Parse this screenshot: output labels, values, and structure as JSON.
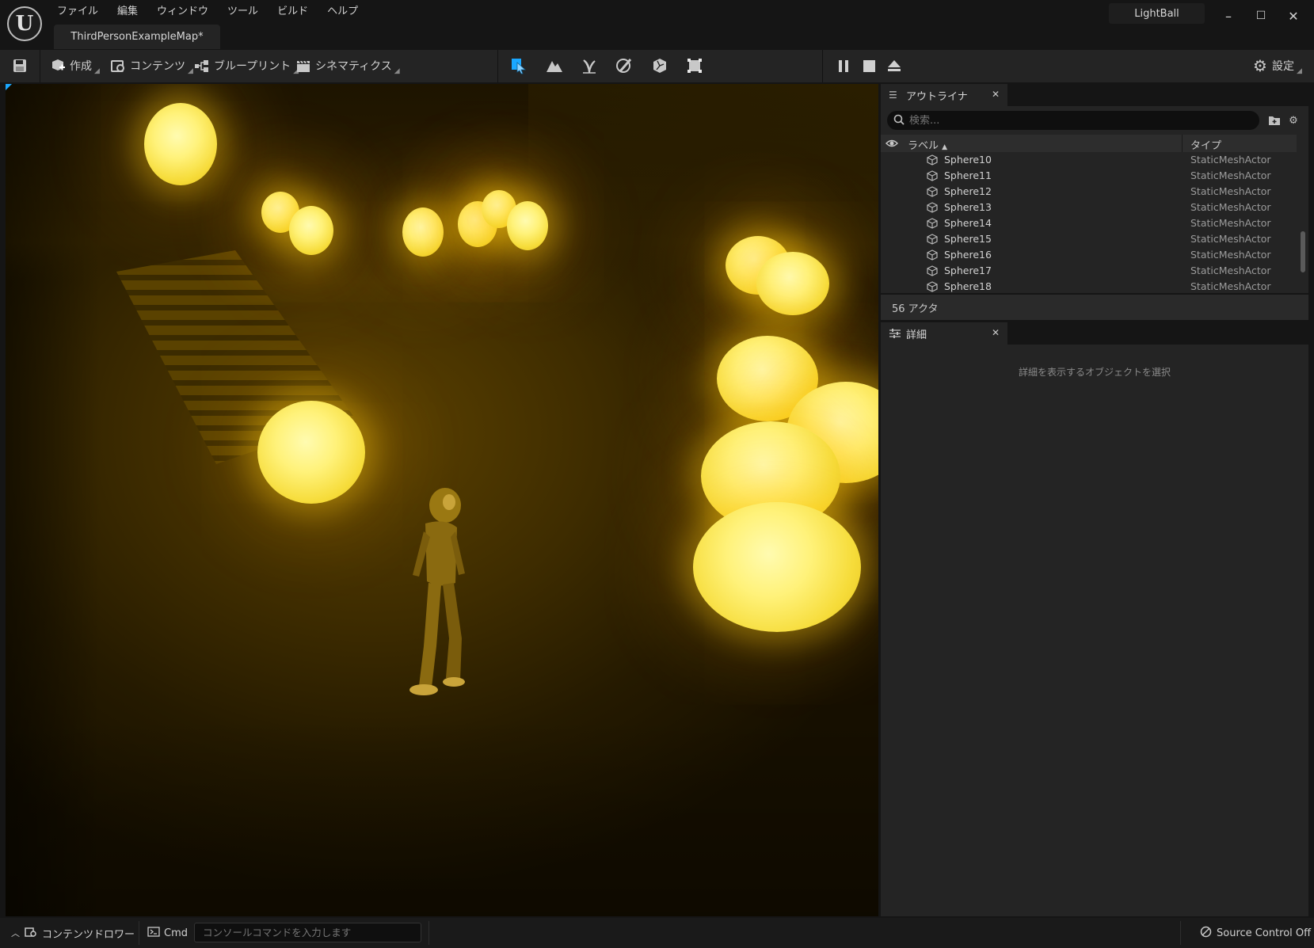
{
  "app": {
    "project_name": "LightBall"
  },
  "menu": [
    "ファイル",
    "編集",
    "ウィンドウ",
    "ツール",
    "ビルド",
    "ヘルプ"
  ],
  "document_tab": {
    "label": "ThirdPersonExampleMap*"
  },
  "window_controls": {
    "minimize": "–",
    "maximize": "☐",
    "close": "✕"
  },
  "toolbar": {
    "create_label": "作成",
    "content_label": "コンテンツ",
    "blueprint_label": "ブループリント",
    "cinematics_label": "シネマティクス",
    "settings_label": "設定",
    "modes": [
      "select-mode-icon",
      "landscape-mode-icon",
      "foliage-mode-icon",
      "mesh-paint-mode-icon",
      "fracture-mode-icon",
      "geometry-mode-icon"
    ],
    "play_controls": [
      "pause-icon",
      "stop-icon",
      "eject-icon"
    ],
    "accent_color": "#1aa7ff"
  },
  "outliner": {
    "tab_label": "アウトライナ",
    "search_placeholder": "検索...",
    "col_label": "ラベル",
    "col_type": "タイプ",
    "rows": [
      {
        "name": "Sphere10",
        "type": "StaticMeshActor"
      },
      {
        "name": "Sphere11",
        "type": "StaticMeshActor"
      },
      {
        "name": "Sphere12",
        "type": "StaticMeshActor"
      },
      {
        "name": "Sphere13",
        "type": "StaticMeshActor"
      },
      {
        "name": "Sphere14",
        "type": "StaticMeshActor"
      },
      {
        "name": "Sphere15",
        "type": "StaticMeshActor"
      },
      {
        "name": "Sphere16",
        "type": "StaticMeshActor"
      },
      {
        "name": "Sphere17",
        "type": "StaticMeshActor"
      },
      {
        "name": "Sphere18",
        "type": "StaticMeshActor"
      }
    ],
    "actor_count": "56 アクタ"
  },
  "details": {
    "tab_label": "詳細",
    "empty_message": "詳細を表示するオブジェクトを選択"
  },
  "statusbar": {
    "content_drawer": "コンテンツドロワー",
    "cmd_label": "Cmd",
    "cmd_placeholder": "コンソールコマンドを入力します",
    "source_control": "Source Control Off"
  }
}
